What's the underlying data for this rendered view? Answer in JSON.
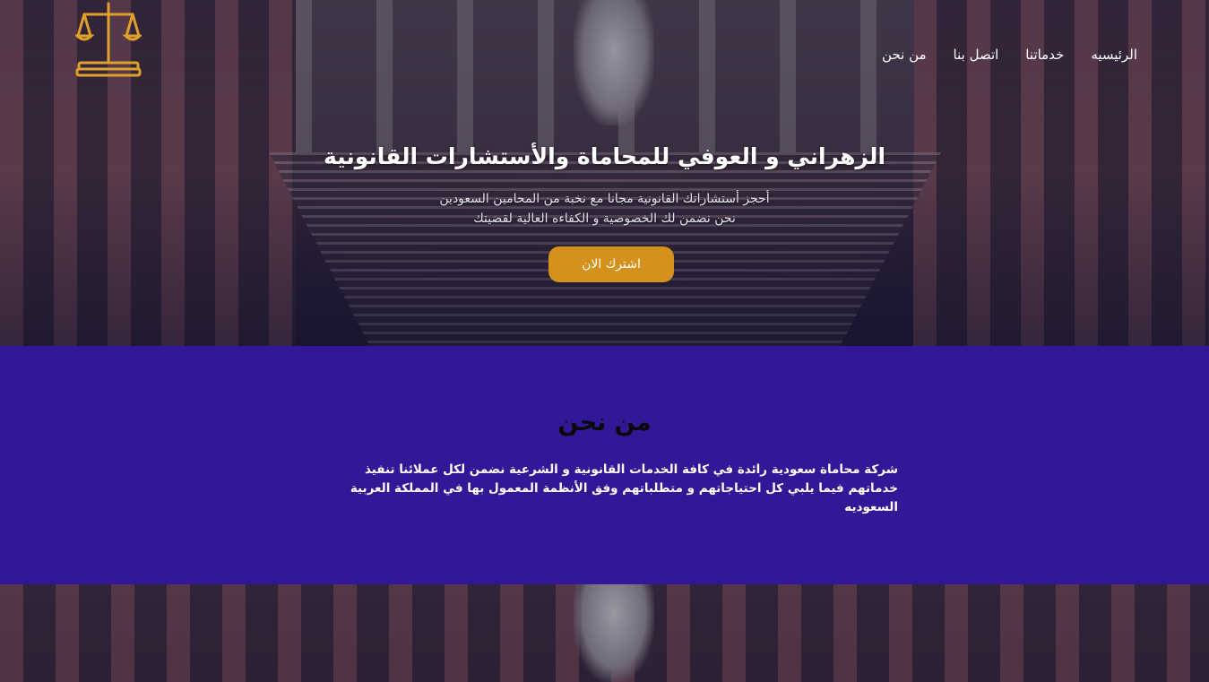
{
  "nav": {
    "items": [
      {
        "label": "الرئيسيه"
      },
      {
        "label": "خدماتنا"
      },
      {
        "label": "اتصل بنا"
      },
      {
        "label": "من نحن"
      }
    ]
  },
  "hero": {
    "title": "الزهراني و العوفي للمحاماة والأستشارات القانونية",
    "subtitle_line1": "أحجز أستشاراتك القانونية مجانا مع نخبة من المحامين السعودين",
    "subtitle_line2": "نحن نضمن لك الخصوصية و الكفاءه العالية لقضيتك",
    "cta_label": "اشترك الان"
  },
  "about": {
    "heading": "من نحن",
    "text": "شركة محاماة سعودية رائدة في كافة الخدمات القانونية و الشرعية نضمن لكل عملائنا تنفيذ خدماتهم فيما يلبي كل احتياجاتهم و متطلباتهم وفق الأنظمة المعمول بها في المملكة العربية السعوديه"
  },
  "colors": {
    "accent": "#d4921c",
    "about_bg": "#321896",
    "logo": "#e0a12a"
  },
  "icons": {
    "logo": "scales-of-justice-icon"
  }
}
